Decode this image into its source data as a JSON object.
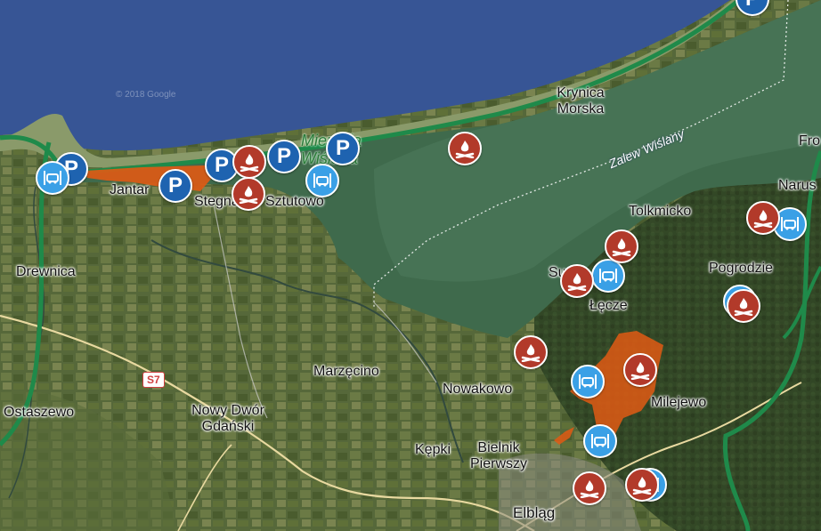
{
  "map": {
    "places": [
      {
        "id": "krynica",
        "text": "Krynica\nMorska"
      },
      {
        "id": "jantar",
        "text": "Jantar"
      },
      {
        "id": "stegna",
        "text": "Stegna"
      },
      {
        "id": "sztutowo",
        "text": "Sztutowo"
      },
      {
        "id": "drewnica",
        "text": "Drewnica"
      },
      {
        "id": "tolkmicko",
        "text": "Tolkmicko"
      },
      {
        "id": "pogrodzie",
        "text": "Pogrodzie"
      },
      {
        "id": "lecze",
        "text": "Łęcze"
      },
      {
        "id": "marzecino",
        "text": "Marzęcino"
      },
      {
        "id": "nowakowo",
        "text": "Nowakowo"
      },
      {
        "id": "milejewo",
        "text": "Milejewo"
      },
      {
        "id": "ostaszewo",
        "text": "Ostaszewo"
      },
      {
        "id": "nowydwor",
        "text": "Nowy Dwór\nGdański"
      },
      {
        "id": "kepki",
        "text": "Kępki"
      },
      {
        "id": "bielnik",
        "text": "Bielnik\nPierwszy"
      },
      {
        "id": "elblag",
        "text": "Elbląg"
      },
      {
        "id": "fro",
        "text": "Fro"
      },
      {
        "id": "narus",
        "text": "Narus"
      },
      {
        "id": "su",
        "text": "Su"
      }
    ],
    "water_label": "Zalew Wiślany",
    "reserve_label": "Mierzeja\nWiślana",
    "road_shield": "S7",
    "copyright": "© 2018 Google",
    "icons": {
      "parking": "parking-icon",
      "campfire": "campfire-icon",
      "car": "car-rental-icon"
    },
    "colors": {
      "sea": "#3b5a9a",
      "lagoon": "#3f6a4c",
      "land": "#4e6232",
      "trail": "#1f8a4a",
      "forest_area": "#e05a14",
      "parking": "#1e63b0",
      "campfire": "#b23a2a",
      "car": "#3aa0e6"
    }
  }
}
